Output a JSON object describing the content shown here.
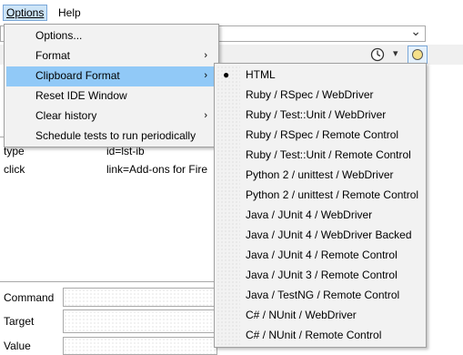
{
  "menubar": {
    "options_label": "Options",
    "help_label": "Help"
  },
  "options_menu": {
    "items": [
      {
        "label": "Options...",
        "has_submenu": false
      },
      {
        "label": "Format",
        "has_submenu": true
      },
      {
        "label": "Clipboard Format",
        "has_submenu": true
      },
      {
        "label": "Reset IDE Window",
        "has_submenu": false
      },
      {
        "label": "Clear history",
        "has_submenu": true
      },
      {
        "label": "Schedule tests to run periodically",
        "has_submenu": false
      }
    ],
    "submenu_arrow": "›"
  },
  "clipboard_submenu": {
    "selected_bullet": "●",
    "items": [
      {
        "label": "HTML"
      },
      {
        "label": "Ruby / RSpec / WebDriver"
      },
      {
        "label": "Ruby / Test::Unit / WebDriver"
      },
      {
        "label": "Ruby / RSpec / Remote Control"
      },
      {
        "label": "Ruby / Test::Unit / Remote Control"
      },
      {
        "label": "Python 2 / unittest / WebDriver"
      },
      {
        "label": "Python 2 / unittest / Remote Control"
      },
      {
        "label": "Java / JUnit 4 / WebDriver"
      },
      {
        "label": "Java / JUnit 4 / WebDriver Backed"
      },
      {
        "label": "Java / JUnit 4 / Remote Control"
      },
      {
        "label": "Java / JUnit 3 / Remote Control"
      },
      {
        "label": "Java / TestNG / Remote Control"
      },
      {
        "label": "C# / NUnit / WebDriver"
      },
      {
        "label": "C# / NUnit / Remote Control"
      }
    ]
  },
  "background": {
    "table_rows": [
      {
        "command": "type",
        "target": "id=lst-ib"
      },
      {
        "command": "click",
        "target": "link=Add-ons for Fire"
      }
    ],
    "command_label": "Command",
    "target_label": "Target",
    "value_label": "Value",
    "dropdown_caret": "⌄",
    "clock_caret": "▾"
  },
  "colors": {
    "menu_bg": "#f2f2f2",
    "highlight": "#91c9f7",
    "menubar_active": "#cce4f7"
  }
}
